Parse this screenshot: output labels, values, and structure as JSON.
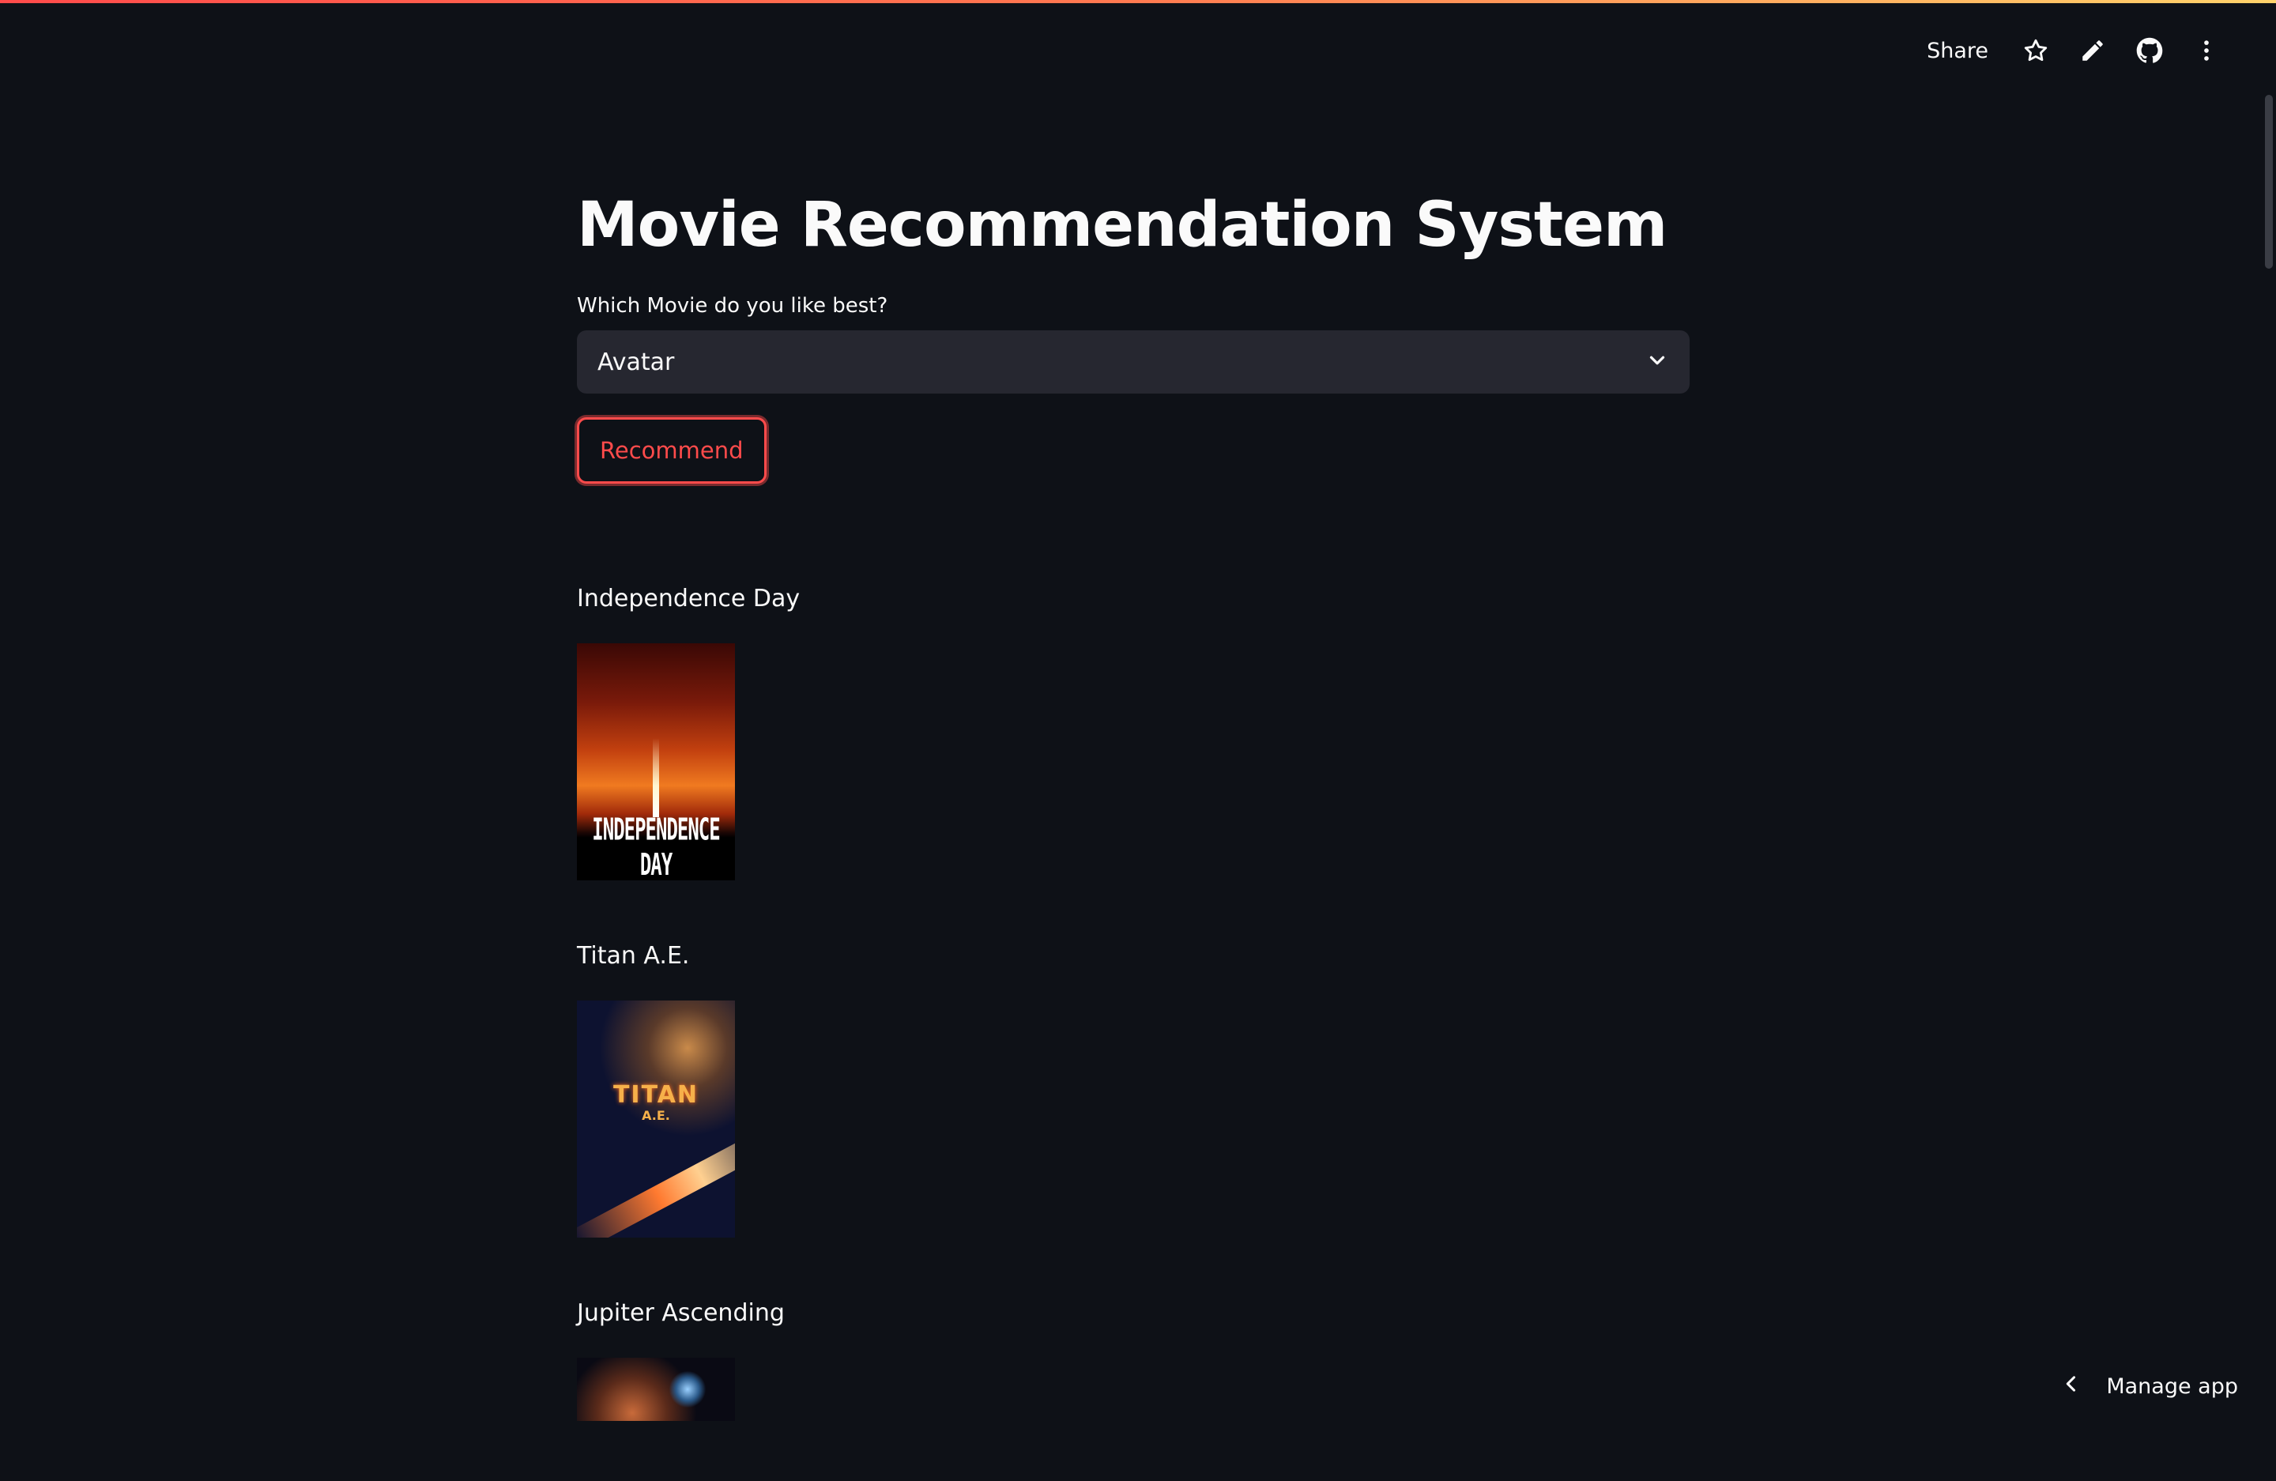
{
  "header": {
    "share_label": "Share",
    "icons": [
      "star-icon",
      "pencil-icon",
      "github-icon",
      "more-vertical-icon"
    ]
  },
  "main": {
    "title": "Movie Recommendation System",
    "select": {
      "label": "Which Movie do you like best?",
      "value": "Avatar"
    },
    "recommend_label": "Recommend"
  },
  "recommendations": [
    {
      "title": "Independence Day",
      "poster_wordmark": "INDEPENDENCE DAY"
    },
    {
      "title": "Titan A.E.",
      "poster_wordmark": "TITAN",
      "poster_subword": "A.E."
    },
    {
      "title": "Jupiter Ascending"
    }
  ],
  "footer": {
    "manage_app_label": "Manage app"
  },
  "colors": {
    "background": "#0e1117",
    "accent": "#ff4b4b",
    "select_bg": "#262730"
  }
}
